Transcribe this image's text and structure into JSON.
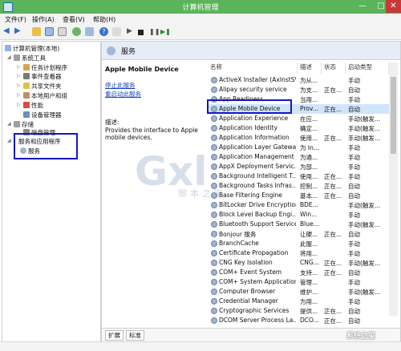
{
  "window": {
    "title": "计算机管理",
    "controls": [
      "—",
      "□",
      "✕"
    ]
  },
  "menu": [
    "文件(F)",
    "操作(A)",
    "查看(V)",
    "帮助(H)"
  ],
  "tree": {
    "root": "计算机管理(本地)",
    "system_tools": "系统工具",
    "task_scheduler": "任务计划程序",
    "event_viewer": "事件查看器",
    "shared_folders": "共享文件夹",
    "local_users": "本地用户和组",
    "performance": "性能",
    "device_manager": "设备管理器",
    "storage": "存储",
    "disk_management": "磁盘管理",
    "services_apps": "服务和应用程序",
    "services": "服务"
  },
  "pane": {
    "title": "服务",
    "selected_service": "Apple Mobile Device",
    "stop_link": "停止此服务",
    "restart_link": "重启动此服务",
    "desc_label": "描述:",
    "desc_text": "Provides the interface to Apple mobile devices."
  },
  "table": {
    "headers": [
      "名称",
      "描述",
      "状态",
      "启动类型"
    ],
    "rows": [
      [
        "ActiveX Installer (AxInstSV)",
        "为从...",
        "",
        "手动"
      ],
      [
        "Alipay security service",
        "为支...",
        "正在...",
        "自动"
      ],
      [
        "App Readiness",
        "当用...",
        "",
        "手动"
      ],
      [
        "Apple Mobile Device",
        "Prov...",
        "正在...",
        "自动"
      ],
      [
        "Application Experience",
        "在应...",
        "",
        "手动(触发..."
      ],
      [
        "Application Identity",
        "确定...",
        "",
        "手动(触发..."
      ],
      [
        "Application Information",
        "使用...",
        "正在...",
        "手动(触发..."
      ],
      [
        "Application Layer Gatewa...",
        "为 In...",
        "",
        "手动"
      ],
      [
        "Application Management",
        "为通...",
        "",
        "手动"
      ],
      [
        "AppX Deployment Servic...",
        "为部...",
        "",
        "手动"
      ],
      [
        "Background Intelligent T...",
        "使用...",
        "正在...",
        "手动"
      ],
      [
        "Background Tasks Infras...",
        "控制...",
        "正在...",
        "自动"
      ],
      [
        "Base Filtering Engine",
        "基本...",
        "正在...",
        "自动"
      ],
      [
        "BitLocker Drive Encryption...",
        "BDE...",
        "",
        "手动(触发..."
      ],
      [
        "Block Level Backup Engi...",
        "Win...",
        "",
        "手动"
      ],
      [
        "Bluetooth Support Service",
        "Blue...",
        "",
        "手动(触发..."
      ],
      [
        "Bonjour 服务",
        "让硬...",
        "正在...",
        "自动"
      ],
      [
        "BranchCache",
        "此服...",
        "",
        "手动"
      ],
      [
        "Certificate Propagation",
        "将用...",
        "",
        "手动"
      ],
      [
        "CNG Key Isolation",
        "CNG...",
        "正在...",
        "手动(触发..."
      ],
      [
        "COM+ Event System",
        "支持...",
        "正在...",
        "自动"
      ],
      [
        "COM+ System Application",
        "管理...",
        "",
        "手动"
      ],
      [
        "Computer Browser",
        "维护...",
        "",
        "手动(触发..."
      ],
      [
        "Credential Manager",
        "为用...",
        "",
        "手动"
      ],
      [
        "Cryptographic Services",
        "提供...",
        "正在...",
        "自动"
      ],
      [
        "DCOM Server Process La...",
        "DCO...",
        "正在...",
        "自动"
      ]
    ]
  },
  "tabs": [
    "扩展",
    "标准"
  ],
  "watermark": {
    "logo": "Gxl",
    "subtitle": "脚本之家",
    "corner": "系统之家"
  },
  "colors": {
    "titlebar": "#5ab45a",
    "highlight": "#1516c8",
    "selection": "#cfe5fb",
    "link": "#1a43c6"
  }
}
